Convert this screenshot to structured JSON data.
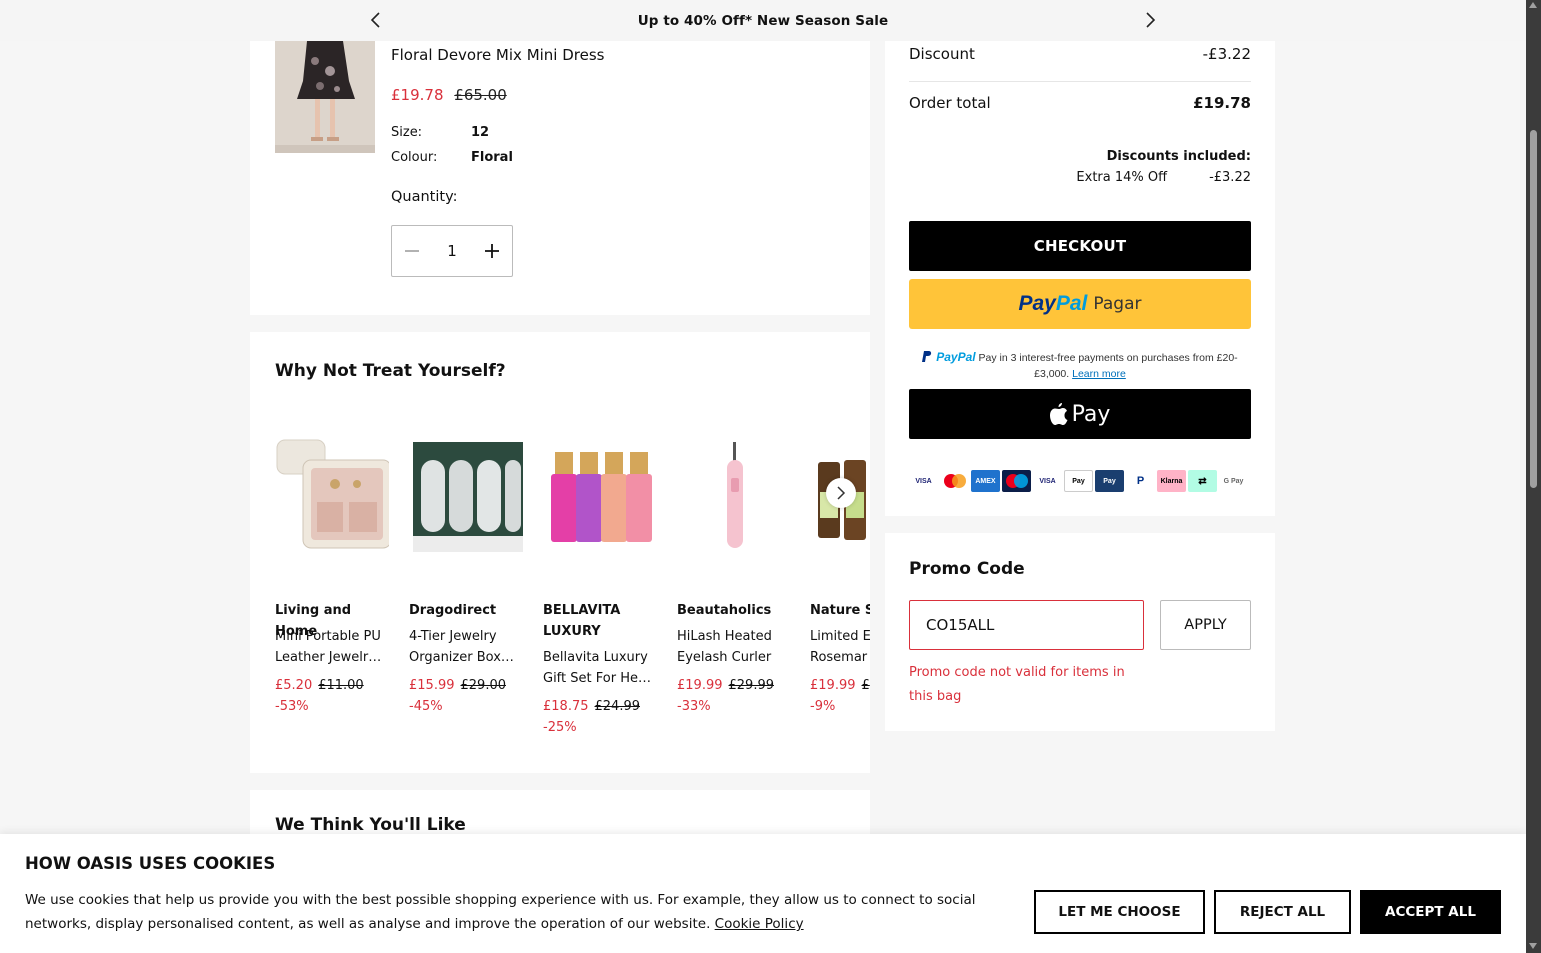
{
  "topbar": {
    "message": "Up to 40% Off* New Season Sale"
  },
  "cart_item": {
    "title": "Floral Devore Mix Mini Dress",
    "price_now": "£19.78",
    "price_was": "£65.00",
    "size_label": "Size:",
    "size_value": "12",
    "colour_label": "Colour:",
    "colour_value": "Floral",
    "quantity_label": "Quantity:",
    "quantity_value": "1"
  },
  "treat": {
    "title": "Why Not Treat Yourself?",
    "items": [
      {
        "brand": "Living and Home",
        "name": "Mini Portable PU Leather Jewelr…",
        "price_now": "£5.20",
        "price_was": "£11.00",
        "discount": "-53%"
      },
      {
        "brand": "Dragodirect",
        "name": "4-Tier Jewelry Organizer Box…",
        "price_now": "£15.99",
        "price_was": "£29.00",
        "discount": "-45%"
      },
      {
        "brand": "BELLAVITA LUXURY",
        "name": "Bellavita Luxury Gift Set For He…",
        "price_now": "£18.75",
        "price_was": "£24.99",
        "discount": "-25%"
      },
      {
        "brand": "Beautaholics",
        "name": "HiLash Heated Eyelash Curler",
        "price_now": "£19.99",
        "price_was": "£29.99",
        "discount": "-33%"
      },
      {
        "brand": "Nature S",
        "name": "Limited E Rosemar",
        "price_now": "£19.99",
        "price_was": "£",
        "discount": "-9%"
      }
    ]
  },
  "like": {
    "title": "We Think You'll Like"
  },
  "summary": {
    "discount_label": "Discount",
    "discount_value": "-£3.22",
    "total_label": "Order total",
    "total_value": "£19.78",
    "discounts_included_label": "Discounts included:",
    "extra_label": "Extra 14% Off",
    "extra_value": "-£3.22",
    "checkout_label": "CHECKOUT",
    "paypal_word_a": "Pay",
    "paypal_word_b": "Pal",
    "paypal_pagar": "Pagar",
    "paypal_msg_brand": "PayPal",
    "paypal_msg": "Pay in 3 interest-free payments on purchases from £20-£3,000.",
    "paypal_learn_more": "Learn more",
    "applepay_label": "Pay",
    "payment_icons": [
      "visa",
      "mastercard",
      "amex",
      "maestro",
      "visa-electron",
      "apple-pay",
      "paypal-pay",
      "paypal",
      "klarna",
      "clearpay",
      "google-pay"
    ]
  },
  "promo": {
    "title": "Promo Code",
    "input_value": "CO15ALL",
    "apply_label": "APPLY",
    "error": "Promo code not valid for items in this bag"
  },
  "cookie": {
    "title": "HOW OASIS USES COOKIES",
    "text": "We use cookies that help us provide you with the best possible shopping experience with us. For example, they allow us to connect to social networks, display personalised content, as well as analyse and improve the operation of our website.",
    "policy_link": "Cookie Policy",
    "btn_choose": "LET ME CHOOSE",
    "btn_reject": "REJECT ALL",
    "btn_accept": "ACCEPT ALL"
  },
  "colors": {
    "accent_red": "#d9303b",
    "paypal_yellow": "#ffc439",
    "black": "#000000"
  }
}
